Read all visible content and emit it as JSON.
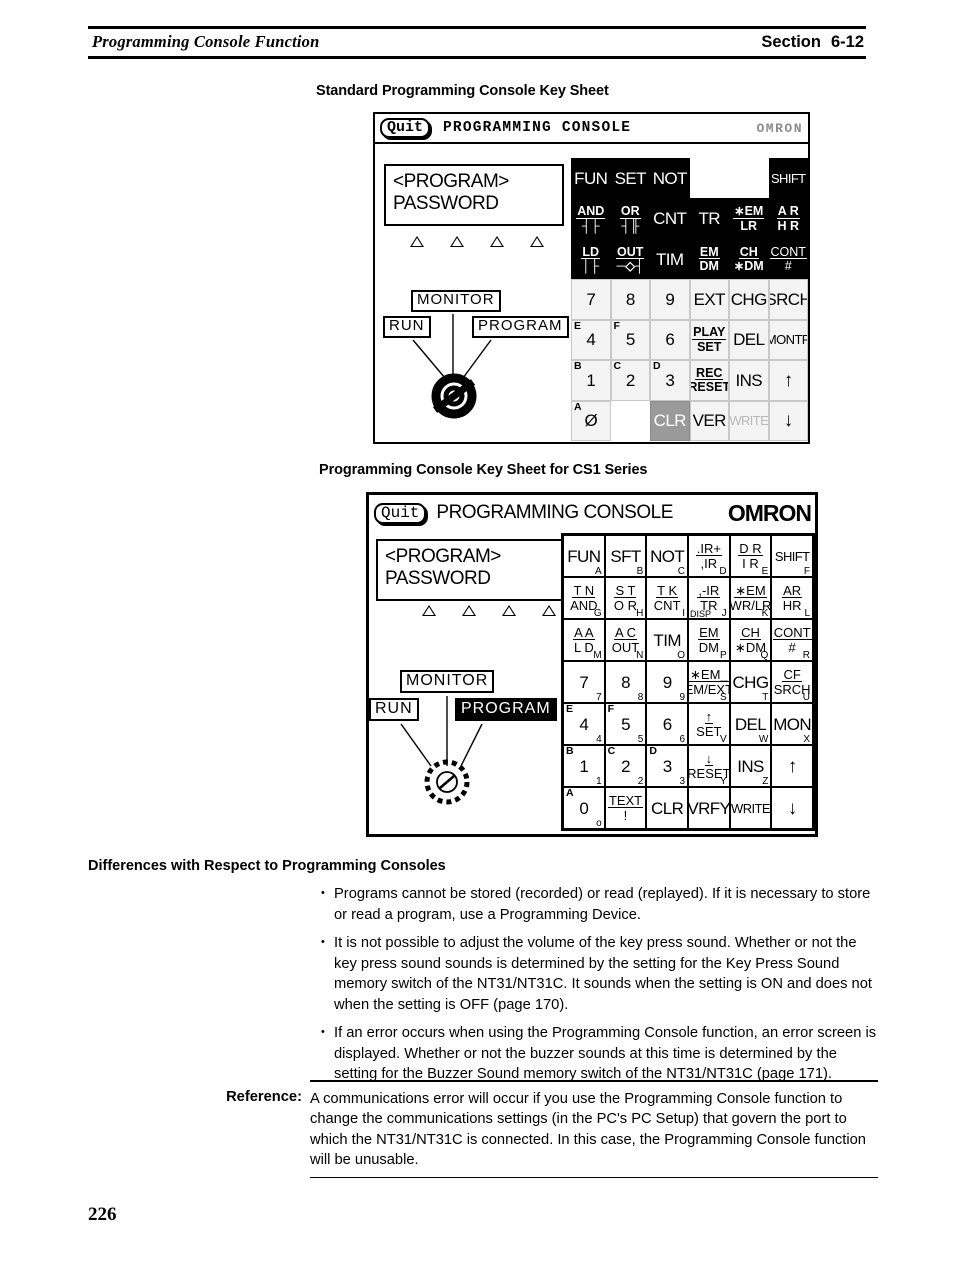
{
  "header": {
    "left_title": "Programming Console Function",
    "section_label": "Section",
    "section_number": "6-12"
  },
  "figures": {
    "standard": {
      "caption": "Standard Programming Console Key Sheet",
      "titlebar": {
        "quit": "Quit",
        "title": "PROGRAMMING  CONSOLE",
        "brand": "OMRON"
      },
      "lcd": {
        "line1": "<PROGRAM>",
        "line2": "PASSWORD"
      },
      "mode_selector": {
        "monitor": "MONITOR",
        "run": "RUN",
        "program": "PROGRAM",
        "selected": "RUN"
      },
      "keys": [
        [
          {
            "main": "FUN",
            "style": "blk"
          },
          {
            "main": "SET",
            "style": "blk"
          },
          {
            "main": "NOT",
            "style": "blk"
          },
          {
            "main": "",
            "style": "empty"
          },
          {
            "main": "",
            "style": "empty"
          },
          {
            "main": "SHIFT",
            "style": "blk"
          }
        ],
        [
          {
            "top": "AND",
            "bot": "┤├",
            "style": "blk",
            "bold": true
          },
          {
            "top": "OR",
            "bot": "┤╟",
            "style": "blk",
            "bold": true
          },
          {
            "main": "CNT",
            "style": "blk"
          },
          {
            "main": "TR",
            "style": "blk"
          },
          {
            "top": "∗EM",
            "bot": "LR",
            "style": "blk",
            "bold": true,
            "rule": true
          },
          {
            "top": "A R",
            "bot": "H R",
            "style": "blk",
            "bold": true
          }
        ],
        [
          {
            "top": "LD",
            "bot": "│├",
            "style": "blk",
            "bold": true
          },
          {
            "top": "OUT",
            "bot": "─◇┤",
            "style": "blk",
            "bold": true
          },
          {
            "main": "TIM",
            "style": "blk"
          },
          {
            "top": "EM",
            "bot": "DM",
            "style": "blk",
            "bold": true,
            "rule": true
          },
          {
            "top": "CH",
            "bot": "∗DM",
            "style": "blk",
            "bold": true,
            "rule": true
          },
          {
            "top": "CONT",
            "bot": "#",
            "style": "blk"
          }
        ],
        [
          {
            "main": "7",
            "style": "wht"
          },
          {
            "main": "8",
            "style": "wht"
          },
          {
            "main": "9",
            "style": "wht"
          },
          {
            "main": "EXT",
            "style": "wht"
          },
          {
            "main": "CHG",
            "style": "wht"
          },
          {
            "main": "SRCH",
            "style": "wht"
          }
        ],
        [
          {
            "main": "4",
            "shift": "E",
            "style": "wht"
          },
          {
            "main": "5",
            "shift": "F",
            "style": "wht"
          },
          {
            "main": "6",
            "style": "wht"
          },
          {
            "top": "PLAY",
            "bot": "SET",
            "style": "wht",
            "bold": true,
            "rule": true
          },
          {
            "main": "DEL",
            "style": "wht"
          },
          {
            "main": "MONTR",
            "style": "wht"
          }
        ],
        [
          {
            "main": "1",
            "shift": "B",
            "style": "wht"
          },
          {
            "main": "2",
            "shift": "C",
            "style": "wht"
          },
          {
            "main": "3",
            "shift": "D",
            "style": "wht"
          },
          {
            "top": "REC",
            "bot": "RESET",
            "style": "wht",
            "bold": true,
            "rule": true
          },
          {
            "main": "INS",
            "style": "wht"
          },
          {
            "main": "↑",
            "style": "wht",
            "arrow": true
          }
        ],
        [
          {
            "main": "Ø",
            "shift": "A",
            "style": "wht"
          },
          {
            "main": "",
            "style": "empty"
          },
          {
            "main": "CLR",
            "style": "sel"
          },
          {
            "main": "VER",
            "style": "wht"
          },
          {
            "main": "WRITE",
            "style": "wht",
            "dim": true
          },
          {
            "main": "↓",
            "style": "wht",
            "arrow": true
          }
        ]
      ]
    },
    "cs1": {
      "caption": "Programming Console Key Sheet for CS1 Series",
      "titlebar": {
        "quit": "Quit",
        "title": "PROGRAMMING   CONSOLE",
        "brand": "OMRON"
      },
      "lcd": {
        "line1": "<PROGRAM>",
        "line2": "PASSWORD"
      },
      "mode_selector": {
        "monitor": "MONITOR",
        "run": "RUN",
        "program": "PROGRAM",
        "selected": "PROGRAM"
      },
      "keys": [
        [
          {
            "main": "FUN",
            "sub": "A"
          },
          {
            "main": "SFT",
            "sub": "B"
          },
          {
            "main": "NOT",
            "sub": "C"
          },
          {
            "top": ".IR+",
            "bot": ",IR",
            "sub": "D",
            "rule": true
          },
          {
            "top": "D R",
            "bot": "I R",
            "sub": "E",
            "rule": true
          },
          {
            "main": "SHIFT",
            "sub": "F"
          }
        ],
        [
          {
            "top": "T N",
            "bot": "AND",
            "sub": "G",
            "rule": true
          },
          {
            "top": "S T",
            "bot": "O R",
            "sub": "H",
            "rule": true
          },
          {
            "top": "T K",
            "bot": "CNT",
            "sub": "I",
            "rule": true
          },
          {
            "top": ",-IR",
            "bot": "TR",
            "sub": "J",
            "subleft": "DISP",
            "rule": true
          },
          {
            "top": "∗EM",
            "bot": "WR/LR",
            "sub": "K",
            "rule": true
          },
          {
            "top": "AR",
            "bot": "HR",
            "sub": "L",
            "rule": true
          }
        ],
        [
          {
            "top": "A A",
            "bot": "L D",
            "sub": "M",
            "rule": true
          },
          {
            "top": "A C",
            "bot": "OUT",
            "sub": "N",
            "rule": true
          },
          {
            "main": "TIM",
            "sub": "O"
          },
          {
            "top": "EM",
            "bot": "DM",
            "sub": "P",
            "rule": true
          },
          {
            "top": "CH",
            "bot": "∗DM",
            "sub": "Q",
            "rule": true
          },
          {
            "top": "CONT",
            "bot": "#",
            "sub": "R"
          }
        ],
        [
          {
            "main": "7",
            "sub": "7"
          },
          {
            "main": "8",
            "sub": "8"
          },
          {
            "main": "9",
            "sub": "9"
          },
          {
            "top": "∗EM_",
            "bot": "EM/EXT",
            "sub": "S",
            "rule": true
          },
          {
            "main": "CHG",
            "sub": "T"
          },
          {
            "top": "CF",
            "bot": "SRCH",
            "sub": "U",
            "rule": true
          }
        ],
        [
          {
            "main": "4",
            "shift": "E",
            "sub": "4"
          },
          {
            "main": "5",
            "shift": "F",
            "sub": "5"
          },
          {
            "main": "6",
            "sub": "6"
          },
          {
            "top": "↑",
            "bot": "SET",
            "sub": "V",
            "rule": true
          },
          {
            "main": "DEL",
            "sub": "W"
          },
          {
            "main": "MON",
            "sub": "X"
          }
        ],
        [
          {
            "main": "1",
            "shift": "B",
            "sub": "1"
          },
          {
            "main": "2",
            "shift": "C",
            "sub": "2"
          },
          {
            "main": "3",
            "shift": "D",
            "sub": "3"
          },
          {
            "top": "↓",
            "bot": "RESET",
            "sub": "Y",
            "rule": true
          },
          {
            "main": "INS",
            "sub": "Z"
          },
          {
            "main": "↑",
            "arrow": true
          }
        ],
        [
          {
            "main": "0",
            "shift": "A",
            "sub": "o"
          },
          {
            "top": "TEXT",
            "bot": "!",
            "rule": true
          },
          {
            "main": "CLR"
          },
          {
            "main": "VRFY"
          },
          {
            "main": "WRITE"
          },
          {
            "main": "↓",
            "arrow": true
          }
        ]
      ]
    }
  },
  "differences": {
    "heading": "Differences with Respect to Programming Consoles",
    "bullets": [
      "Programs cannot be stored (recorded) or read (replayed). If it is necessary to store or read a program, use a Programming Device.",
      "It is not possible to adjust the volume of the key press sound. Whether or not the key press sound sounds is determined by the setting for the Key Press Sound memory switch of the NT31/NT31C. It sounds when the setting is ON and does not when the setting is OFF (page 170).",
      "If an error occurs when using the Programming Console function, an error screen is displayed. Whether or not the buzzer sounds at this time is determined by the setting for the Buzzer Sound memory switch of the NT31/NT31C (page 171)."
    ]
  },
  "reference": {
    "label": "Reference:",
    "text": "A communications error will occur if you use the Programming Console function to change the communications settings (in the PC's PC Setup) that govern the port to which the NT31/NT31C is connected. In this case, the Programming Console function will be unusable."
  },
  "page_number": "226"
}
